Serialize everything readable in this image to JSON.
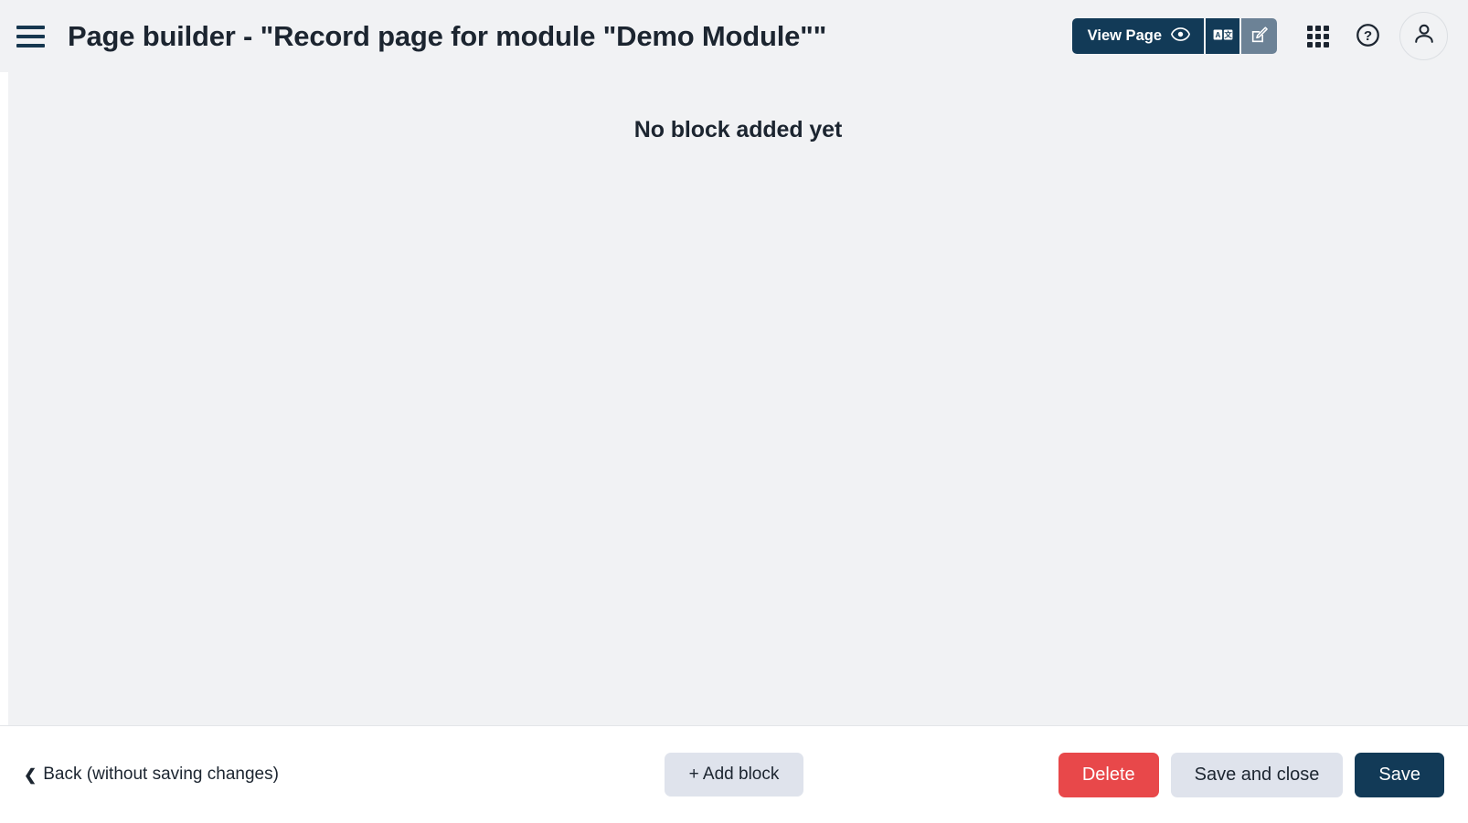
{
  "header": {
    "menu_icon": "hamburger-icon",
    "title": "Page builder - \"Record page for module \"Demo Module\"\"",
    "view_page_label": "View Page",
    "view_page_icon": "eye-icon",
    "translate_icon": "translate-icon",
    "edit_icon": "edit-pencil-icon",
    "apps_icon": "apps-grid-icon",
    "help_icon": "help-circle-icon",
    "avatar_icon": "user-avatar-icon"
  },
  "main": {
    "empty_message": "No block added yet"
  },
  "footer": {
    "back_label": "Back (without saving changes)",
    "back_chevron": "chevron-left-icon",
    "add_block_label": "+ Add block",
    "delete_label": "Delete",
    "save_and_close_label": "Save and close",
    "save_label": "Save"
  },
  "colors": {
    "primary_dark": "#123a57",
    "active_toggle": "#6c8296",
    "danger": "#e8484a",
    "neutral_button": "#dfe3ec",
    "canvas_bg": "#f1f2f4",
    "text_dark": "#1c2530"
  }
}
